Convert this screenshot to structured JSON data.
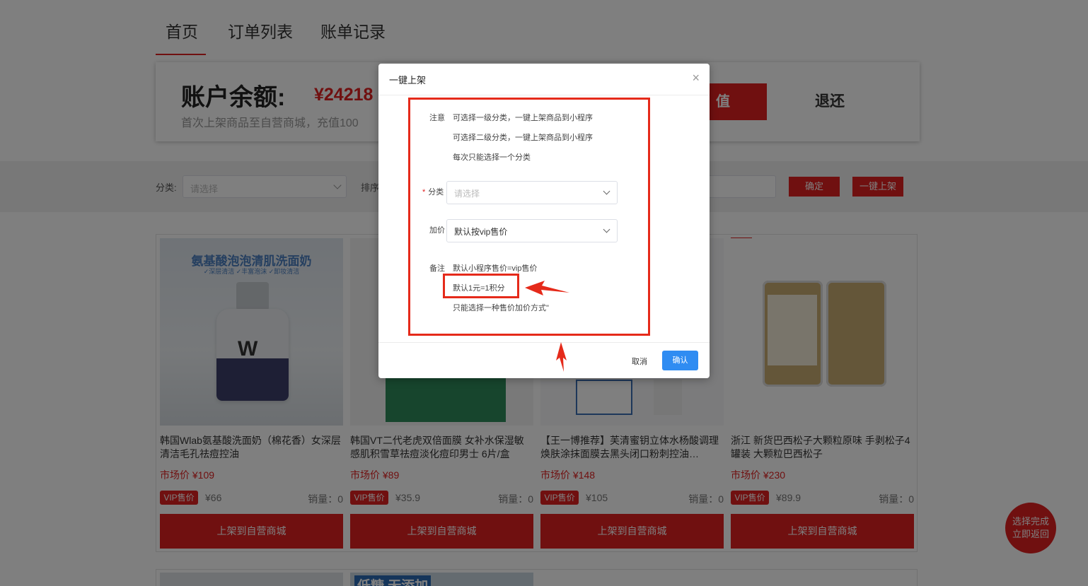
{
  "nav": {
    "tabs": [
      {
        "label": "首页"
      },
      {
        "label": "订单列表"
      },
      {
        "label": "账单记录"
      }
    ]
  },
  "balance": {
    "title": "账户余额:",
    "amount": "¥24218",
    "note": "首次上架商品至自营商城，充值100",
    "recharge_label": "值",
    "refund_label": "退还"
  },
  "filters": {
    "category_label": "分类:",
    "category_placeholder": "请选择",
    "sort_label": "排序",
    "confirm_label": "确定",
    "one_click_label": "一键上架"
  },
  "products": [
    {
      "name": "韩国Wlab氨基酸洗面奶（棉花香）女深层清洁毛孔祛痘控油",
      "market_price": "市场价 ¥109",
      "vip_badge": "VIP售价",
      "vip_price": "¥66",
      "sales": "销量：0",
      "button": "上架到自营商城",
      "image_title": "氨基酸泡泡清肌洗面奶",
      "image_tags": "✓深层清洁   ✓丰富泡沫   ✓卸妆清洁"
    },
    {
      "name": "韩国VT二代老虎双倍面膜 女补水保湿敏感肌积雪草祛痘淡化痘印男士 6片/盒",
      "market_price": "市场价 ¥89",
      "vip_badge": "VIP售价",
      "vip_price": "¥35.9",
      "sales": "销量：0",
      "button": "上架到自营商城"
    },
    {
      "name": "【王一博推荐】芙清蜜钥立体水杨酸调理焕肤涂抹面膜去黑头闭口粉刺控油…",
      "market_price": "市场价 ¥148",
      "vip_badge": "VIP售价",
      "vip_price": "¥105",
      "sales": "销量：0",
      "button": "上架到自营商城"
    },
    {
      "name": "浙江 新货巴西松子大颗粒原味 手剥松子4罐装 大颗粒巴西松子",
      "market_price": "市场价 ¥230",
      "vip_badge": "VIP售价",
      "vip_price": "¥89.9",
      "sales": "销量：0",
      "button": "上架到自营商城"
    }
  ],
  "row2": {
    "thumb_text": "低糖 无添加"
  },
  "float_button": {
    "line1": "选择完成",
    "line2": "立即返回"
  },
  "dialog": {
    "title": "一键上架",
    "close": "×",
    "notice_label": "注意",
    "notice_lines": [
      "可选择一级分类，一键上架商品到小程序",
      "可选择二级分类，一键上架商品到小程序",
      "每次只能选择一个分类"
    ],
    "category_required": "*",
    "category_label": "分类",
    "category_placeholder": "请选择",
    "markup_label": "加价",
    "markup_value": "默认按vip售价",
    "remark_label": "备注",
    "remark_lines": [
      "默认小程序售价=vip售价",
      "默认1元=1积分",
      "只能选择一种售价加价方式\""
    ],
    "cancel_label": "取消",
    "confirm_label": "确认"
  },
  "colors": {
    "accent": "#e02020",
    "primary_blue": "#2f8cf2",
    "annotation_red": "#e52a1a"
  }
}
